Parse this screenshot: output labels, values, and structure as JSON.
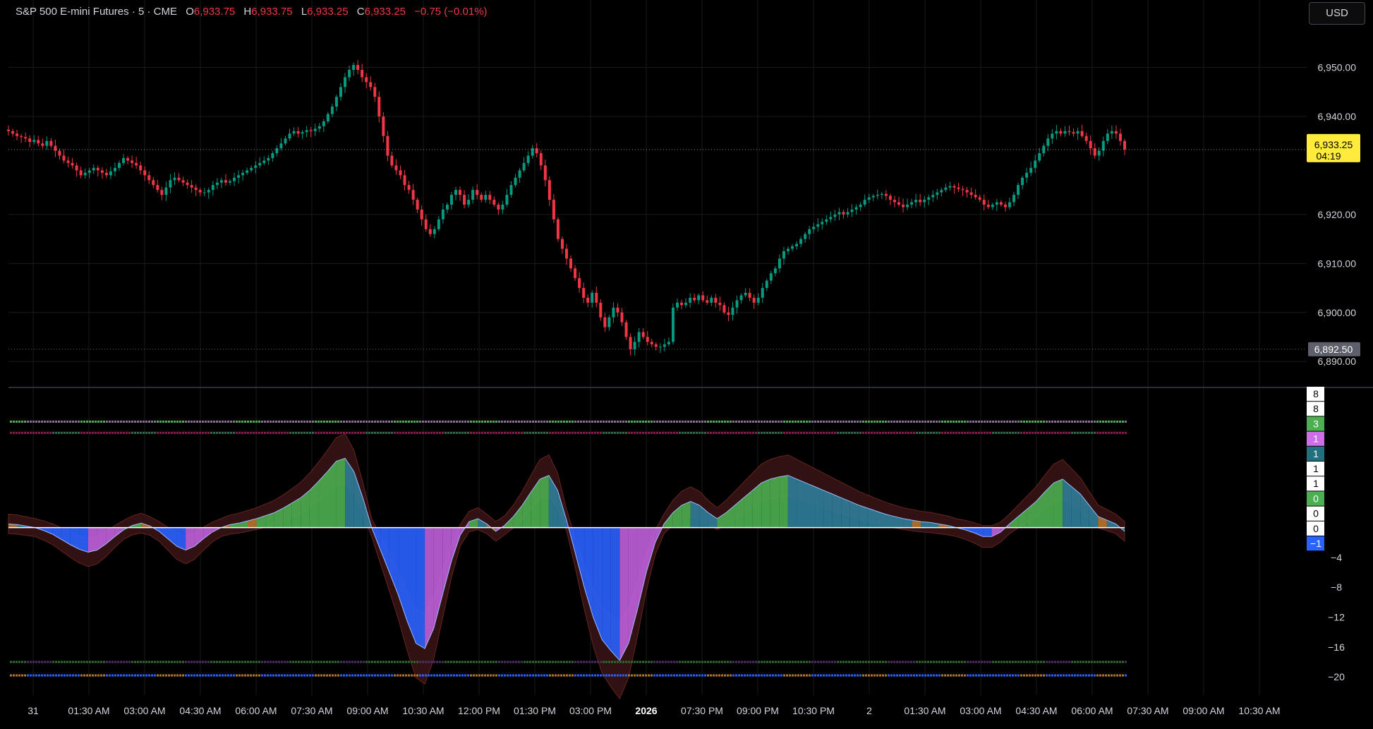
{
  "instrument": {
    "name": "S&P 500 E-mini Futures",
    "interval": "5",
    "exchange": "CME",
    "o_label": "O",
    "o_value": "6,933.75",
    "h_label": "H",
    "h_value": "6,933.75",
    "l_label": "L",
    "l_value": "6,933.25",
    "c_label": "C",
    "c_value": "6,933.25",
    "change": "−0.75 (−0.01%)"
  },
  "currency_button": "USD",
  "price_tag": {
    "price": "6,933.25",
    "countdown": "04:19",
    "color": "#ffeb3b"
  },
  "low_tag": {
    "price": "6,892.50",
    "color": "#5d606b"
  },
  "colors": {
    "up": "#089981",
    "down": "#f23645",
    "grid": "#1a1a1a",
    "divider": "#2a2e39"
  },
  "chart_data": [
    {
      "type": "candlestick",
      "series": [
        {
          "name": "",
          "values": [
            6937.0,
            6936.5,
            6936.0,
            6935.8,
            6935.5,
            6934.8,
            6935.2,
            6934.5,
            6934.0,
            6935.0,
            6934.0,
            6933.0,
            6932.0,
            6931.0,
            6930.5,
            6930.0,
            6929.0,
            6928.0,
            6928.5,
            6929.0,
            6929.5,
            6929.0,
            6928.5,
            6928.0,
            6928.8,
            6929.5,
            6930.5,
            6931.5,
            6931.0,
            6930.5,
            6930.0,
            6929.0,
            6928.0,
            6927.0,
            6926.0,
            6925.0,
            6924.0,
            6925.5,
            6927.0,
            6927.5,
            6927.0,
            6926.5,
            6926.0,
            6925.5,
            6925.0,
            6924.5,
            6924.5,
            6925.0,
            6926.0,
            6926.5,
            6927.0,
            6926.5,
            6926.8,
            6927.5,
            6928.0,
            6928.5,
            6929.0,
            6929.5,
            6930.0,
            6930.5,
            6931.0,
            6931.5,
            6932.5,
            6933.5,
            6934.5,
            6935.5,
            6936.5,
            6937.0,
            6936.5,
            6936.8,
            6937.2,
            6937.0,
            6937.5,
            6938.0,
            6939.0,
            6940.5,
            6942.0,
            6944.0,
            6946.0,
            6948.0,
            6949.5,
            6950.5,
            6949.5,
            6948.0,
            6947.0,
            6946.0,
            6944.0,
            6940.0,
            6936.0,
            6932.0,
            6930.0,
            6929.0,
            6928.0,
            6926.0,
            6925.0,
            6923.0,
            6921.0,
            6919.0,
            6917.0,
            6916.0,
            6917.0,
            6919.0,
            6921.0,
            6922.0,
            6924.0,
            6925.0,
            6924.0,
            6922.0,
            6923.0,
            6925.0,
            6924.0,
            6923.0,
            6924.0,
            6923.0,
            6922.0,
            6921.0,
            6922.0,
            6924.0,
            6926.0,
            6927.5,
            6929.0,
            6930.5,
            6932.0,
            6933.5,
            6932.5,
            6930.0,
            6927.0,
            6923.0,
            6919.0,
            6915.0,
            6913.0,
            6911.0,
            6909.0,
            6907.0,
            6905.0,
            6903.0,
            6902.0,
            6904.0,
            6902.0,
            6899.0,
            6897.0,
            6899.0,
            6901.0,
            6900.0,
            6898.0,
            6895.0,
            6892.5,
            6894.0,
            6896.0,
            6895.0,
            6894.0,
            6893.5,
            6893.0,
            6893.0,
            6893.5,
            6894.0,
            6901.0,
            6902.0,
            6901.5,
            6902.0,
            6903.0,
            6902.5,
            6903.5,
            6902.5,
            6902.0,
            6903.0,
            6902.0,
            6901.5,
            6900.0,
            6899.5,
            6901.0,
            6902.5,
            6903.5,
            6904.0,
            6903.0,
            6902.0,
            6903.0,
            6905.0,
            6906.5,
            6908.0,
            6909.0,
            6911.0,
            6912.5,
            6913.0,
            6913.5,
            6914.0,
            6915.0,
            6916.0,
            6917.0,
            6917.5,
            6918.0,
            6918.5,
            6919.0,
            6919.5,
            6920.0,
            6920.5,
            6920.0,
            6920.5,
            6921.0,
            6921.5,
            6922.0,
            6923.0,
            6923.5,
            6923.8,
            6924.0,
            6924.2,
            6923.8,
            6923.0,
            6922.5,
            6922.0,
            6921.5,
            6922.0,
            6922.5,
            6923.0,
            6922.5,
            6923.0,
            6923.5,
            6924.0,
            6924.5,
            6925.0,
            6925.5,
            6925.8,
            6925.5,
            6925.2,
            6925.0,
            6924.5,
            6924.0,
            6923.5,
            6923.0,
            6922.0,
            6921.5,
            6922.0,
            6922.5,
            6922.0,
            6921.5,
            6922.5,
            6924.0,
            6926.0,
            6927.5,
            6928.5,
            6929.5,
            6931.0,
            6932.5,
            6934.0,
            6935.5,
            6936.5,
            6937.0,
            6936.5,
            6937.0,
            6936.8,
            6936.5,
            6937.0,
            6936.0,
            6935.0,
            6933.5,
            6932.0,
            6933.0,
            6935.0,
            6936.5,
            6937.0,
            6936.5,
            6935.0,
            6933.25
          ]
        }
      ],
      "price_labels": [
        "6,950.00",
        "6,940.00",
        "6,920.00",
        "6,910.00",
        "6,900.00",
        "6,890.00"
      ],
      "price_label_values": [
        6950,
        6940,
        6920,
        6910,
        6900,
        6890
      ],
      "ylim": [
        6886,
        6958
      ],
      "time_labels": [
        "31",
        "01:30 AM",
        "03:00 AM",
        "04:30 AM",
        "06:00 AM",
        "07:30 AM",
        "09:00 AM",
        "10:30 AM",
        "12:00 PM",
        "01:30 PM",
        "03:00 PM",
        "2026",
        "07:30 PM",
        "09:00 PM",
        "10:30 PM",
        "2",
        "01:30 AM",
        "03:00 AM",
        "04:30 AM",
        "06:00 AM",
        "07:30 AM",
        "09:00 AM",
        "10:30 AM"
      ]
    },
    {
      "type": "area",
      "series": [
        {
          "name": "",
          "values": [
            0.5,
            0.4,
            0.2,
            0.0,
            -0.4,
            -0.9,
            -1.6,
            -2.3,
            -2.9,
            -3.3,
            -3.0,
            -2.2,
            -1.2,
            -0.3,
            0.3,
            0.6,
            0.2,
            -0.5,
            -1.5,
            -2.5,
            -3.0,
            -2.5,
            -1.5,
            -0.6,
            0.0,
            0.4,
            0.6,
            0.9,
            1.2,
            1.6,
            2.0,
            2.6,
            3.3,
            4.0,
            5.0,
            6.2,
            7.5,
            8.9,
            9.3,
            7.5,
            4.0,
            0.0,
            -3.0,
            -6.0,
            -9.0,
            -12.5,
            -15.5,
            -16.2,
            -13.5,
            -9.0,
            -4.5,
            -1.0,
            0.8,
            1.2,
            0.5,
            -0.5,
            0.3,
            1.5,
            3.0,
            4.8,
            6.5,
            7.0,
            5.0,
            1.0,
            -3.5,
            -8.0,
            -12.0,
            -15.0,
            -16.5,
            -17.8,
            -15.5,
            -11.0,
            -6.0,
            -2.0,
            0.5,
            2.0,
            3.0,
            3.5,
            3.0,
            2.0,
            1.2,
            2.0,
            3.0,
            4.0,
            5.0,
            6.0,
            6.5,
            6.8,
            7.0,
            6.5,
            6.0,
            5.5,
            5.0,
            4.5,
            4.0,
            3.5,
            3.0,
            2.6,
            2.2,
            1.8,
            1.5,
            1.2,
            1.0,
            0.8,
            0.7,
            0.5,
            0.3,
            0.0,
            -0.3,
            -0.7,
            -1.2,
            -1.2,
            -0.6,
            0.5,
            1.5,
            2.5,
            3.5,
            4.8,
            6.0,
            6.5,
            5.5,
            4.5,
            3.0,
            1.5,
            1.0,
            0.5,
            -0.5
          ]
        }
      ],
      "oscillator_labels": [
        "8",
        "8",
        "3",
        "1",
        "1",
        "1",
        "1",
        "0",
        "0",
        "0",
        "−1"
      ],
      "oscillator_label_colors": [
        "#ffffff",
        "#ffffff",
        "#4caf50",
        "#ce6ee8",
        "#21707f",
        "#ffffff",
        "#ffffff",
        "#4caf50",
        "#ffffff",
        "#ffffff",
        "#2962ff"
      ],
      "scale_labels": [
        "−4",
        "−8",
        "−12",
        "−16",
        "−20"
      ],
      "scale_label_values": [
        -4,
        -8,
        -12,
        -16,
        -20
      ],
      "ylim": [
        -21.5,
        18.5
      ]
    }
  ]
}
